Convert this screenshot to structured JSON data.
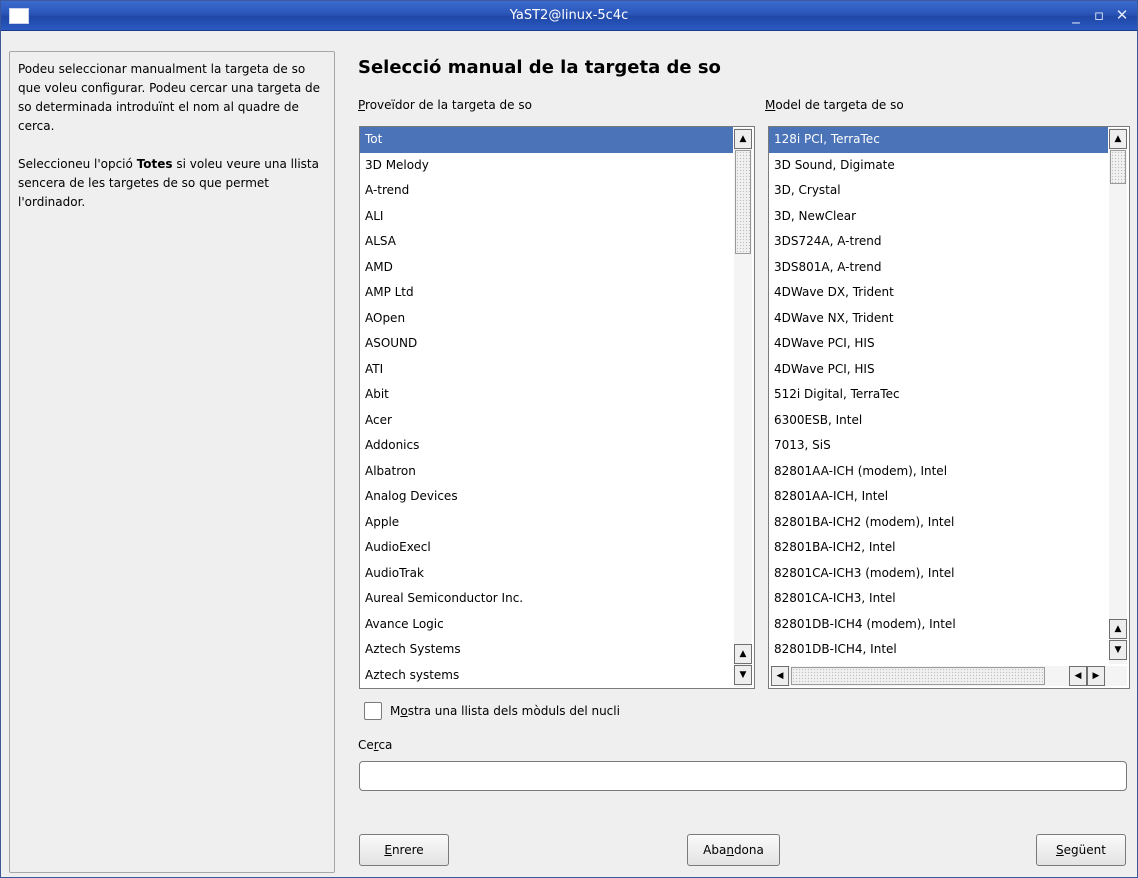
{
  "window": {
    "title": "YaST2@linux-5c4c",
    "minimize_glyph": "_",
    "maximize_glyph": "▫",
    "close_glyph": "✕"
  },
  "help": {
    "paragraph1": "Podeu seleccionar manualment la targeta de so que voleu configurar. Podeu cercar una targeta de so determinada introduïnt el nom al quadre de cerca.",
    "paragraph2_before": "Seleccioneu l'opció ",
    "paragraph2_bold": "Totes",
    "paragraph2_after": " si voleu veure una llista sencera de les targetes de so que permet l'ordinador."
  },
  "main": {
    "heading": "Selecció manual de la targeta de so",
    "vendor_label_first": "P",
    "vendor_label_rest": "roveïdor de la targeta de so",
    "model_label_first": "M",
    "model_label_rest": "odel de targeta de so",
    "vendors": [
      "Tot",
      "3D Melody",
      "A-trend",
      "ALI",
      "ALSA",
      "AMD",
      "AMP Ltd",
      "AOpen",
      "ASOUND",
      "ATI",
      "Abit",
      "Acer",
      "Addonics",
      "Albatron",
      "Analog Devices",
      "Apple",
      "AudioExecl",
      "AudioTrak",
      "Aureal Semiconductor Inc.",
      "Avance Logic",
      "Aztech Systems",
      "Aztech systems"
    ],
    "models": [
      "128i PCI, TerraTec",
      "3D Sound, Digimate",
      "3D, Crystal",
      "3D, NewClear",
      "3DS724A, A-trend",
      "3DS801A, A-trend",
      "4DWave DX, Trident",
      "4DWave NX, Trident",
      "4DWave PCI, HIS",
      "4DWave PCI, HIS",
      "512i Digital, TerraTec",
      "6300ESB, Intel",
      "7013, SiS",
      "82801AA-ICH (modem), Intel",
      "82801AA-ICH, Intel",
      "82801BA-ICH2 (modem), Intel",
      "82801BA-ICH2, Intel",
      "82801CA-ICH3 (modem), Intel",
      "82801CA-ICH3, Intel",
      "82801DB-ICH4 (modem), Intel",
      "82801DB-ICH4, Intel"
    ],
    "checkbox_label_pre": "M",
    "checkbox_label_mn": "o",
    "checkbox_label_post": "stra una llista dels mòduls del nucli",
    "search_label_pre": "Ce",
    "search_label_mn": "r",
    "search_label_post": "ca",
    "search_value": ""
  },
  "buttons": {
    "back_mn": "E",
    "back_rest": "nrere",
    "abort_pre": "Aba",
    "abort_mn": "n",
    "abort_post": "dona",
    "next_mn": "S",
    "next_rest": "egüent"
  }
}
